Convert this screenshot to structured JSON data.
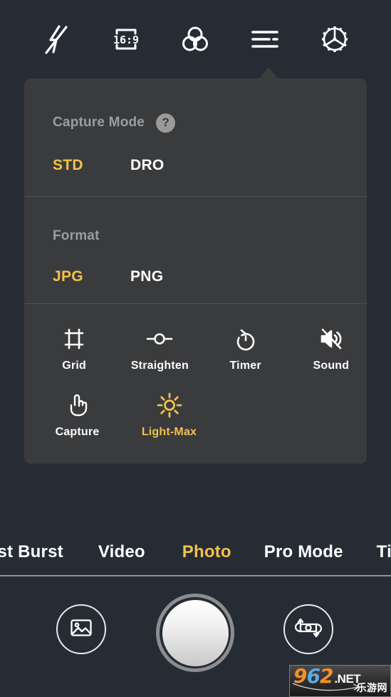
{
  "theme": {
    "background": "#262c33",
    "panel_background": "#3a3b3d",
    "accent": "#f2c14b",
    "text_primary": "#ffffff",
    "text_muted": "#9b9da0"
  },
  "topbar": {
    "buttons": [
      {
        "name": "flash-off-icon",
        "label": "Flash Off"
      },
      {
        "name": "aspect-ratio-icon",
        "label": "16:9"
      },
      {
        "name": "filter-icon",
        "label": "Filters"
      },
      {
        "name": "menu-icon",
        "label": "More Settings"
      },
      {
        "name": "settings-gear-icon",
        "label": "Settings"
      }
    ],
    "aspect_ratio_value": "16:9",
    "active_button": "menu-icon"
  },
  "panel": {
    "capture_mode": {
      "title": "Capture Mode",
      "help": "?",
      "options": [
        {
          "label": "STD",
          "active": true
        },
        {
          "label": "DRO",
          "active": false
        }
      ]
    },
    "format": {
      "title": "Format",
      "options": [
        {
          "label": "JPG",
          "active": true
        },
        {
          "label": "PNG",
          "active": false
        }
      ]
    },
    "toggles": [
      {
        "label": "Grid",
        "icon": "grid-icon",
        "on": false
      },
      {
        "label": "Straighten",
        "icon": "straighten-icon",
        "on": false
      },
      {
        "label": "Timer",
        "icon": "timer-icon",
        "on": false
      },
      {
        "label": "Sound",
        "icon": "sound-off-icon",
        "on": false
      },
      {
        "label": "Capture",
        "icon": "touch-capture-icon",
        "on": false
      },
      {
        "label": "Light-Max",
        "icon": "sun-icon",
        "on": true
      }
    ]
  },
  "modes": [
    {
      "label": "ast Burst",
      "active": false
    },
    {
      "label": "Video",
      "active": false
    },
    {
      "label": "Photo",
      "active": true
    },
    {
      "label": "Pro Mode",
      "active": false
    },
    {
      "label": "Time",
      "active": false
    }
  ],
  "bottombar": {
    "gallery": "gallery-icon",
    "shutter": "shutter-button",
    "switch_camera": "switch-camera-icon"
  },
  "watermark": {
    "digit_9": "9",
    "digit_6": "6",
    "digit_2": "2",
    "net": ".NET",
    "chinese": "乐游网"
  }
}
